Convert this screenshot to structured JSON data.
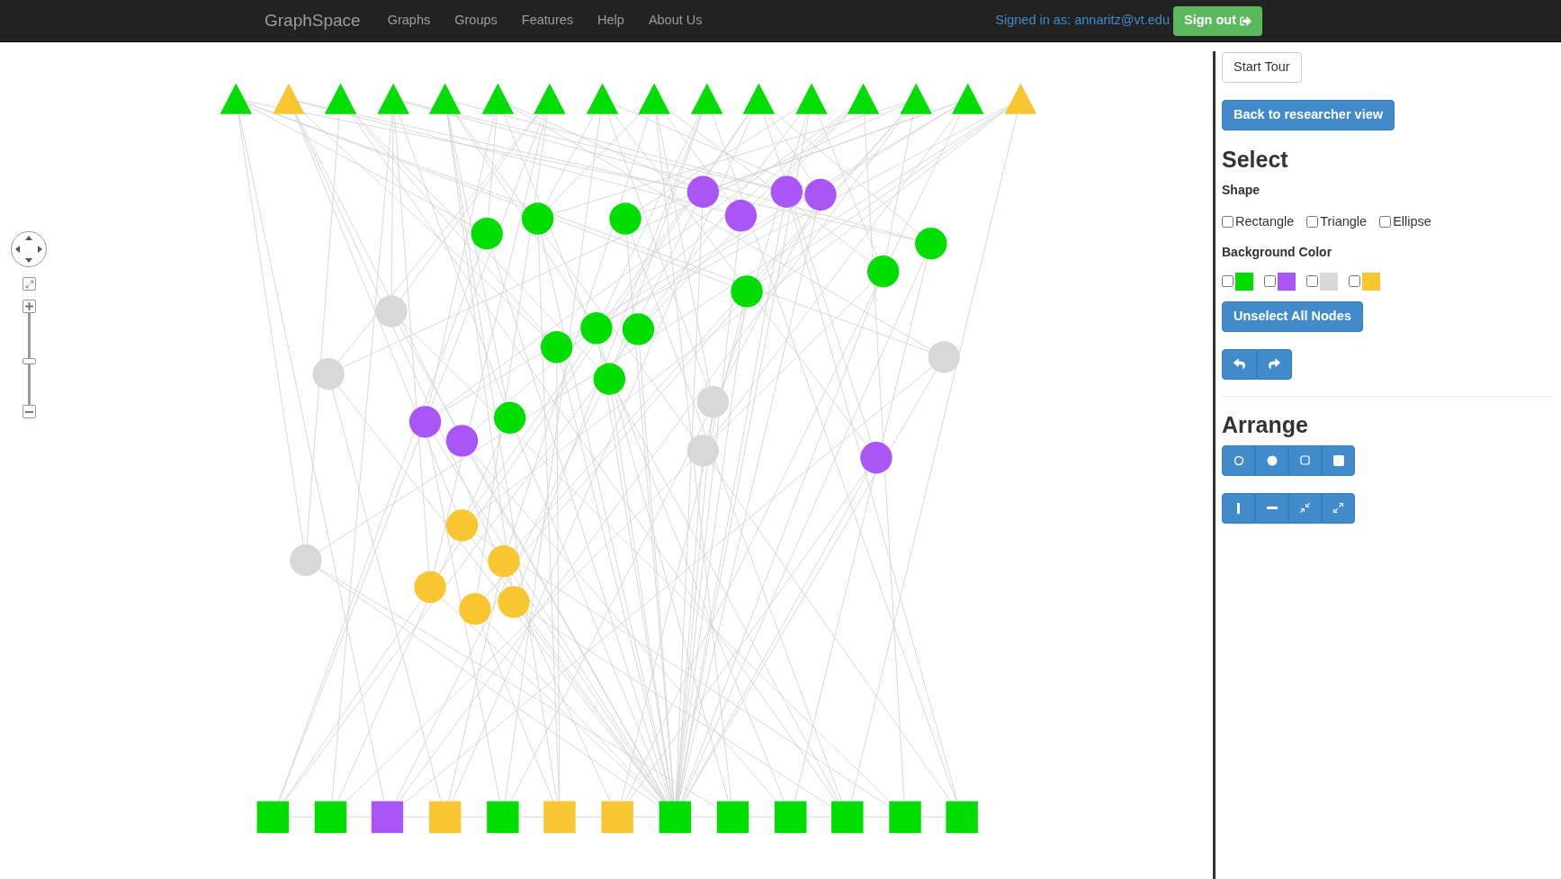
{
  "navbar": {
    "brand": "GraphSpace",
    "links": [
      "Graphs",
      "Groups",
      "Features",
      "Help",
      "About Us"
    ],
    "signed_in": "Signed in as: annaritz@vt.edu",
    "sign_out": "Sign out"
  },
  "zoom": {
    "level": 0.47
  },
  "graph": {
    "nodes": [
      {
        "kind": "triangle",
        "color": "#00dd00"
      },
      {
        "kind": "triangle",
        "color": "#f8c630"
      },
      {
        "kind": "triangle",
        "color": "#00dd00"
      },
      {
        "kind": "triangle",
        "color": "#00dd00"
      },
      {
        "kind": "triangle",
        "color": "#00dd00"
      },
      {
        "kind": "triangle",
        "color": "#00dd00"
      },
      {
        "kind": "triangle",
        "color": "#00dd00"
      },
      {
        "kind": "triangle",
        "color": "#00dd00"
      },
      {
        "kind": "triangle",
        "color": "#00dd00"
      },
      {
        "kind": "triangle",
        "color": "#00dd00"
      },
      {
        "kind": "triangle",
        "color": "#00dd00"
      },
      {
        "kind": "triangle",
        "color": "#00dd00"
      },
      {
        "kind": "triangle",
        "color": "#00dd00"
      },
      {
        "kind": "triangle",
        "color": "#00dd00"
      },
      {
        "kind": "triangle",
        "color": "#00dd00"
      },
      {
        "kind": "triangle",
        "color": "#f8c630"
      },
      {
        "kind": "circle",
        "color": "#00dd00"
      },
      {
        "kind": "circle",
        "color": "#00dd00"
      },
      {
        "kind": "circle",
        "color": "#00dd00"
      },
      {
        "kind": "circle",
        "color": "#aa55f5"
      },
      {
        "kind": "circle",
        "color": "#aa55f5"
      },
      {
        "kind": "circle",
        "color": "#aa55f5"
      },
      {
        "kind": "circle",
        "color": "#aa55f5"
      },
      {
        "kind": "circle",
        "color": "#00dd00"
      },
      {
        "kind": "circle",
        "color": "#00dd00"
      },
      {
        "kind": "circle",
        "color": "#00dd00"
      },
      {
        "kind": "circle",
        "color": "#d8d8d8"
      },
      {
        "kind": "circle",
        "color": "#d8d8d8"
      },
      {
        "kind": "circle",
        "color": "#00dd00"
      },
      {
        "kind": "circle",
        "color": "#00dd00"
      },
      {
        "kind": "circle",
        "color": "#00dd00"
      },
      {
        "kind": "circle",
        "color": "#00dd00"
      },
      {
        "kind": "circle",
        "color": "#d8d8d8"
      },
      {
        "kind": "circle",
        "color": "#d8d8d8"
      },
      {
        "kind": "circle",
        "color": "#d8d8d8"
      },
      {
        "kind": "circle",
        "color": "#aa55f5"
      },
      {
        "kind": "circle",
        "color": "#aa55f5"
      },
      {
        "kind": "circle",
        "color": "#00dd00"
      },
      {
        "kind": "circle",
        "color": "#aa55f5"
      },
      {
        "kind": "circle",
        "color": "#f8c630"
      },
      {
        "kind": "circle",
        "color": "#f8c630"
      },
      {
        "kind": "circle",
        "color": "#d8d8d8"
      },
      {
        "kind": "circle",
        "color": "#f8c630"
      },
      {
        "kind": "circle",
        "color": "#f8c630"
      },
      {
        "kind": "circle",
        "color": "#f8c630"
      },
      {
        "kind": "square",
        "color": "#00dd00"
      },
      {
        "kind": "square",
        "color": "#00dd00"
      },
      {
        "kind": "square",
        "color": "#aa55f5"
      },
      {
        "kind": "square",
        "color": "#f8c630"
      },
      {
        "kind": "square",
        "color": "#00dd00"
      },
      {
        "kind": "square",
        "color": "#f8c630"
      },
      {
        "kind": "square",
        "color": "#f8c630"
      },
      {
        "kind": "square",
        "color": "#00dd00"
      },
      {
        "kind": "square",
        "color": "#00dd00"
      },
      {
        "kind": "square",
        "color": "#00dd00"
      },
      {
        "kind": "square",
        "color": "#00dd00"
      },
      {
        "kind": "square",
        "color": "#00dd00"
      },
      {
        "kind": "square",
        "color": "#00dd00"
      }
    ]
  },
  "panel": {
    "start_tour": "Start Tour",
    "back": "Back to researcher view",
    "select": {
      "title": "Select",
      "shape_label": "Shape",
      "shapes": [
        {
          "label": "Rectangle",
          "checked": false
        },
        {
          "label": "Triangle",
          "checked": false
        },
        {
          "label": "Ellipse",
          "checked": false
        }
      ],
      "color_label": "Background Color",
      "colors": [
        {
          "color": "#00dd00",
          "checked": false
        },
        {
          "color": "#aa55f5",
          "checked": false
        },
        {
          "color": "#d8d8d8",
          "checked": false
        },
        {
          "color": "#f8c630",
          "checked": false
        }
      ],
      "unselect": "Unselect All Nodes"
    },
    "arrange": {
      "title": "Arrange"
    }
  }
}
